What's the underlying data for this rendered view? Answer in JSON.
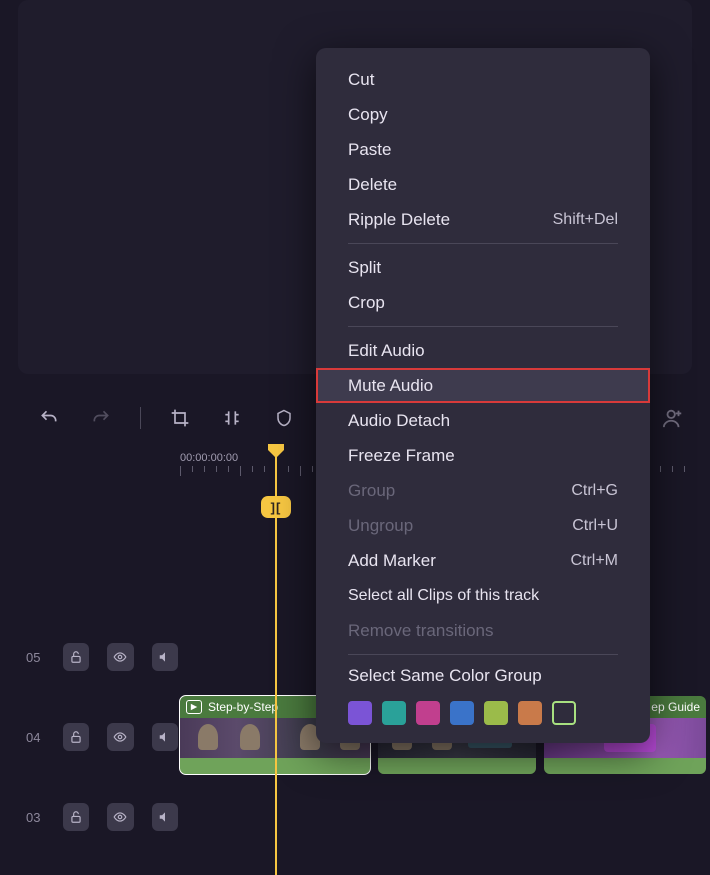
{
  "ruler": {
    "timecode_start": "00:00:00:00",
    "trim_badge": "]["
  },
  "tracks": [
    {
      "num": "05"
    },
    {
      "num": "04"
    },
    {
      "num": "03"
    }
  ],
  "clips": [
    {
      "title": "Step-by-Step"
    },
    {
      "title": ""
    },
    {
      "title": "ep Guide"
    }
  ],
  "context_menu": {
    "items": [
      {
        "label": "Cut",
        "shortcut": "",
        "group": 1
      },
      {
        "label": "Copy",
        "shortcut": "",
        "group": 1
      },
      {
        "label": "Paste",
        "shortcut": "",
        "group": 1
      },
      {
        "label": "Delete",
        "shortcut": "",
        "group": 1
      },
      {
        "label": "Ripple Delete",
        "shortcut": "Shift+Del",
        "group": 1
      },
      {
        "label": "Split",
        "shortcut": "",
        "group": 2
      },
      {
        "label": "Crop",
        "shortcut": "",
        "group": 2
      },
      {
        "label": "Edit Audio",
        "shortcut": "",
        "group": 3
      },
      {
        "label": "Mute Audio",
        "shortcut": "",
        "group": 3,
        "highlight": true
      },
      {
        "label": "Audio Detach",
        "shortcut": "",
        "group": 3
      },
      {
        "label": "Freeze Frame",
        "shortcut": "",
        "group": 3
      },
      {
        "label": "Group",
        "shortcut": "Ctrl+G",
        "group": 3,
        "disabled": true
      },
      {
        "label": "Ungroup",
        "shortcut": "Ctrl+U",
        "group": 3,
        "disabled": true
      },
      {
        "label": "Add Marker",
        "shortcut": "Ctrl+M",
        "group": 3
      },
      {
        "label": "Select all Clips of this track",
        "shortcut": "",
        "group": 3
      },
      {
        "label": "Remove transitions",
        "shortcut": "",
        "group": 3,
        "disabled": true
      },
      {
        "label": "Select Same Color Group",
        "shortcut": "",
        "group": 4
      }
    ],
    "colors": [
      "#7b54d6",
      "#2aa199",
      "#c13f8e",
      "#3a73c9",
      "#9bbb4a",
      "#c97a4a",
      "outlined"
    ]
  }
}
